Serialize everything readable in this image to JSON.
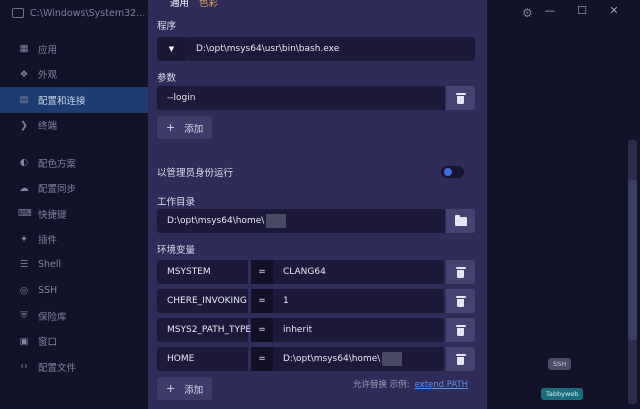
{
  "window": {
    "title": "C:\\Windows\\System32...",
    "controls": [
      "—",
      "☐",
      "✕"
    ]
  },
  "sidebar": {
    "items": [
      {
        "label": "应用",
        "icon": "apps-icon",
        "glyph": "▦"
      },
      {
        "label": "外观",
        "icon": "puzzle-icon",
        "glyph": "❖"
      },
      {
        "label": "配置和连接",
        "icon": "profiles-icon",
        "glyph": "▤",
        "active": true
      },
      {
        "label": "终端",
        "icon": "terminal-icon",
        "glyph": "❯"
      },
      {
        "label": "配色方案",
        "icon": "palette-icon",
        "glyph": "◐"
      },
      {
        "label": "配置同步",
        "icon": "cloud-icon",
        "glyph": "☁"
      },
      {
        "label": "快捷键",
        "icon": "keyboard-icon",
        "glyph": "⌨"
      },
      {
        "label": "插件",
        "icon": "plugin-icon",
        "glyph": "✦"
      },
      {
        "label": "Shell",
        "icon": "list-icon",
        "glyph": "☰"
      },
      {
        "label": "SSH",
        "icon": "globe-icon",
        "glyph": "◎"
      },
      {
        "label": "保险库",
        "icon": "vault-icon",
        "glyph": "⛨"
      },
      {
        "label": "窗口",
        "icon": "window-icon",
        "glyph": "▣"
      },
      {
        "label": "配置文件",
        "icon": "code-icon",
        "glyph": "‹›"
      }
    ]
  },
  "badges": {
    "ssh": "SSH",
    "tabbyweb": "Tabbyweb"
  },
  "modal": {
    "tabs": {
      "general": "通用",
      "colors": "色彩"
    },
    "program": {
      "label": "程序",
      "value": "D:\\opt\\msys64\\usr\\bin\\bash.exe"
    },
    "args": {
      "label": "参数",
      "value": "--login",
      "add_label": "添加"
    },
    "run_as_admin": {
      "label": "以管理员身份运行",
      "enabled": true
    },
    "working_dir": {
      "label": "工作目录",
      "value": "D:\\opt\\msys64\\home\\"
    },
    "env": {
      "label": "环境变量",
      "rows": [
        {
          "key": "MSYSTEM",
          "eq": "=",
          "value": "CLANG64"
        },
        {
          "key": "CHERE_INVOKING",
          "eq": "=",
          "value": "1"
        },
        {
          "key": "MSYS2_PATH_TYPE",
          "eq": "=",
          "value": "inherit"
        },
        {
          "key": "HOME",
          "eq": "=",
          "value": "D:\\opt\\msys64\\home\\"
        }
      ],
      "add_label": "添加",
      "hint": "允许替换 示例:",
      "hint_link": "extend PATH"
    }
  },
  "colors": {
    "accent_blue": "#3b6ee0",
    "warn_tab": "#e2a54e",
    "modal_bg": "#302c5a"
  }
}
